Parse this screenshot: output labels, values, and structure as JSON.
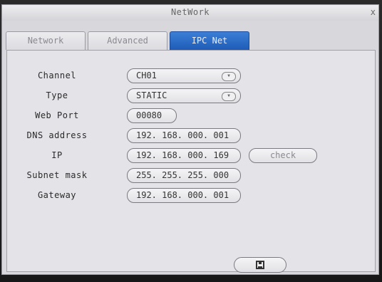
{
  "window": {
    "title": "NetWork",
    "close_label": "x"
  },
  "tabs": [
    {
      "label": "Network",
      "active": false
    },
    {
      "label": "Advanced",
      "active": false
    },
    {
      "label": "IPC Net",
      "active": true
    }
  ],
  "form": {
    "channel": {
      "label": "Channel",
      "value": "CH01"
    },
    "type": {
      "label": "Type",
      "value": "STATIC"
    },
    "web_port": {
      "label": "Web Port",
      "value": "00080"
    },
    "dns_address": {
      "label": "DNS address",
      "value": "192. 168. 000. 001"
    },
    "ip": {
      "label": "IP",
      "value": "192. 168. 000. 169"
    },
    "subnet_mask": {
      "label": "Subnet mask",
      "value": "255. 255. 255. 000"
    },
    "gateway": {
      "label": "Gateway",
      "value": "192. 168. 000. 001"
    }
  },
  "buttons": {
    "check_label": "check",
    "save_icon": "save-icon"
  },
  "colors": {
    "active_tab": "#2a6ac8",
    "panel": "#e4e4e8"
  }
}
